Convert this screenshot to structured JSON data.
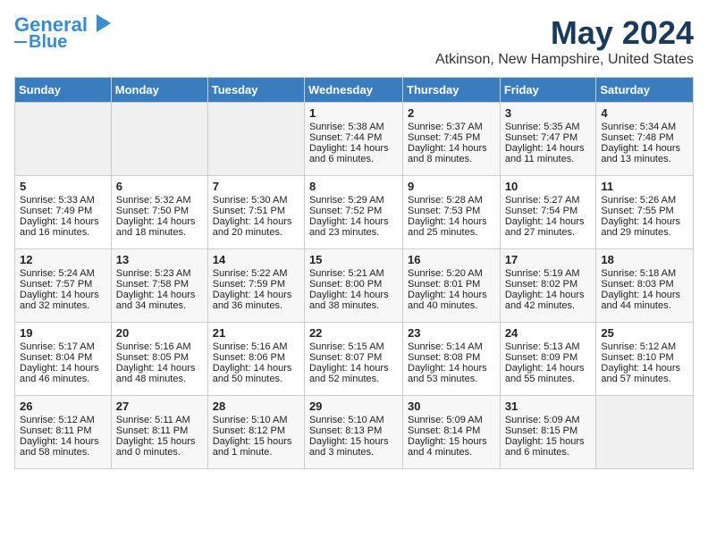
{
  "header": {
    "logo_line1": "General",
    "logo_line2": "Blue",
    "month": "May 2024",
    "location": "Atkinson, New Hampshire, United States"
  },
  "weekdays": [
    "Sunday",
    "Monday",
    "Tuesday",
    "Wednesday",
    "Thursday",
    "Friday",
    "Saturday"
  ],
  "weeks": [
    [
      {
        "day": "",
        "empty": true
      },
      {
        "day": "",
        "empty": true
      },
      {
        "day": "",
        "empty": true
      },
      {
        "day": "1",
        "sunrise": "5:38 AM",
        "sunset": "7:44 PM",
        "daylight": "14 hours and 6 minutes."
      },
      {
        "day": "2",
        "sunrise": "5:37 AM",
        "sunset": "7:45 PM",
        "daylight": "14 hours and 8 minutes."
      },
      {
        "day": "3",
        "sunrise": "5:35 AM",
        "sunset": "7:47 PM",
        "daylight": "14 hours and 11 minutes."
      },
      {
        "day": "4",
        "sunrise": "5:34 AM",
        "sunset": "7:48 PM",
        "daylight": "14 hours and 13 minutes."
      }
    ],
    [
      {
        "day": "5",
        "sunrise": "5:33 AM",
        "sunset": "7:49 PM",
        "daylight": "14 hours and 16 minutes."
      },
      {
        "day": "6",
        "sunrise": "5:32 AM",
        "sunset": "7:50 PM",
        "daylight": "14 hours and 18 minutes."
      },
      {
        "day": "7",
        "sunrise": "5:30 AM",
        "sunset": "7:51 PM",
        "daylight": "14 hours and 20 minutes."
      },
      {
        "day": "8",
        "sunrise": "5:29 AM",
        "sunset": "7:52 PM",
        "daylight": "14 hours and 23 minutes."
      },
      {
        "day": "9",
        "sunrise": "5:28 AM",
        "sunset": "7:53 PM",
        "daylight": "14 hours and 25 minutes."
      },
      {
        "day": "10",
        "sunrise": "5:27 AM",
        "sunset": "7:54 PM",
        "daylight": "14 hours and 27 minutes."
      },
      {
        "day": "11",
        "sunrise": "5:26 AM",
        "sunset": "7:55 PM",
        "daylight": "14 hours and 29 minutes."
      }
    ],
    [
      {
        "day": "12",
        "sunrise": "5:24 AM",
        "sunset": "7:57 PM",
        "daylight": "14 hours and 32 minutes."
      },
      {
        "day": "13",
        "sunrise": "5:23 AM",
        "sunset": "7:58 PM",
        "daylight": "14 hours and 34 minutes."
      },
      {
        "day": "14",
        "sunrise": "5:22 AM",
        "sunset": "7:59 PM",
        "daylight": "14 hours and 36 minutes."
      },
      {
        "day": "15",
        "sunrise": "5:21 AM",
        "sunset": "8:00 PM",
        "daylight": "14 hours and 38 minutes."
      },
      {
        "day": "16",
        "sunrise": "5:20 AM",
        "sunset": "8:01 PM",
        "daylight": "14 hours and 40 minutes."
      },
      {
        "day": "17",
        "sunrise": "5:19 AM",
        "sunset": "8:02 PM",
        "daylight": "14 hours and 42 minutes."
      },
      {
        "day": "18",
        "sunrise": "5:18 AM",
        "sunset": "8:03 PM",
        "daylight": "14 hours and 44 minutes."
      }
    ],
    [
      {
        "day": "19",
        "sunrise": "5:17 AM",
        "sunset": "8:04 PM",
        "daylight": "14 hours and 46 minutes."
      },
      {
        "day": "20",
        "sunrise": "5:16 AM",
        "sunset": "8:05 PM",
        "daylight": "14 hours and 48 minutes."
      },
      {
        "day": "21",
        "sunrise": "5:16 AM",
        "sunset": "8:06 PM",
        "daylight": "14 hours and 50 minutes."
      },
      {
        "day": "22",
        "sunrise": "5:15 AM",
        "sunset": "8:07 PM",
        "daylight": "14 hours and 52 minutes."
      },
      {
        "day": "23",
        "sunrise": "5:14 AM",
        "sunset": "8:08 PM",
        "daylight": "14 hours and 53 minutes."
      },
      {
        "day": "24",
        "sunrise": "5:13 AM",
        "sunset": "8:09 PM",
        "daylight": "14 hours and 55 minutes."
      },
      {
        "day": "25",
        "sunrise": "5:12 AM",
        "sunset": "8:10 PM",
        "daylight": "14 hours and 57 minutes."
      }
    ],
    [
      {
        "day": "26",
        "sunrise": "5:12 AM",
        "sunset": "8:11 PM",
        "daylight": "14 hours and 58 minutes."
      },
      {
        "day": "27",
        "sunrise": "5:11 AM",
        "sunset": "8:11 PM",
        "daylight": "15 hours and 0 minutes."
      },
      {
        "day": "28",
        "sunrise": "5:10 AM",
        "sunset": "8:12 PM",
        "daylight": "15 hours and 1 minute."
      },
      {
        "day": "29",
        "sunrise": "5:10 AM",
        "sunset": "8:13 PM",
        "daylight": "15 hours and 3 minutes."
      },
      {
        "day": "30",
        "sunrise": "5:09 AM",
        "sunset": "8:14 PM",
        "daylight": "15 hours and 4 minutes."
      },
      {
        "day": "31",
        "sunrise": "5:09 AM",
        "sunset": "8:15 PM",
        "daylight": "15 hours and 6 minutes."
      },
      {
        "day": "",
        "empty": true
      }
    ]
  ],
  "labels": {
    "sunrise": "Sunrise:",
    "sunset": "Sunset:",
    "daylight": "Daylight:"
  }
}
